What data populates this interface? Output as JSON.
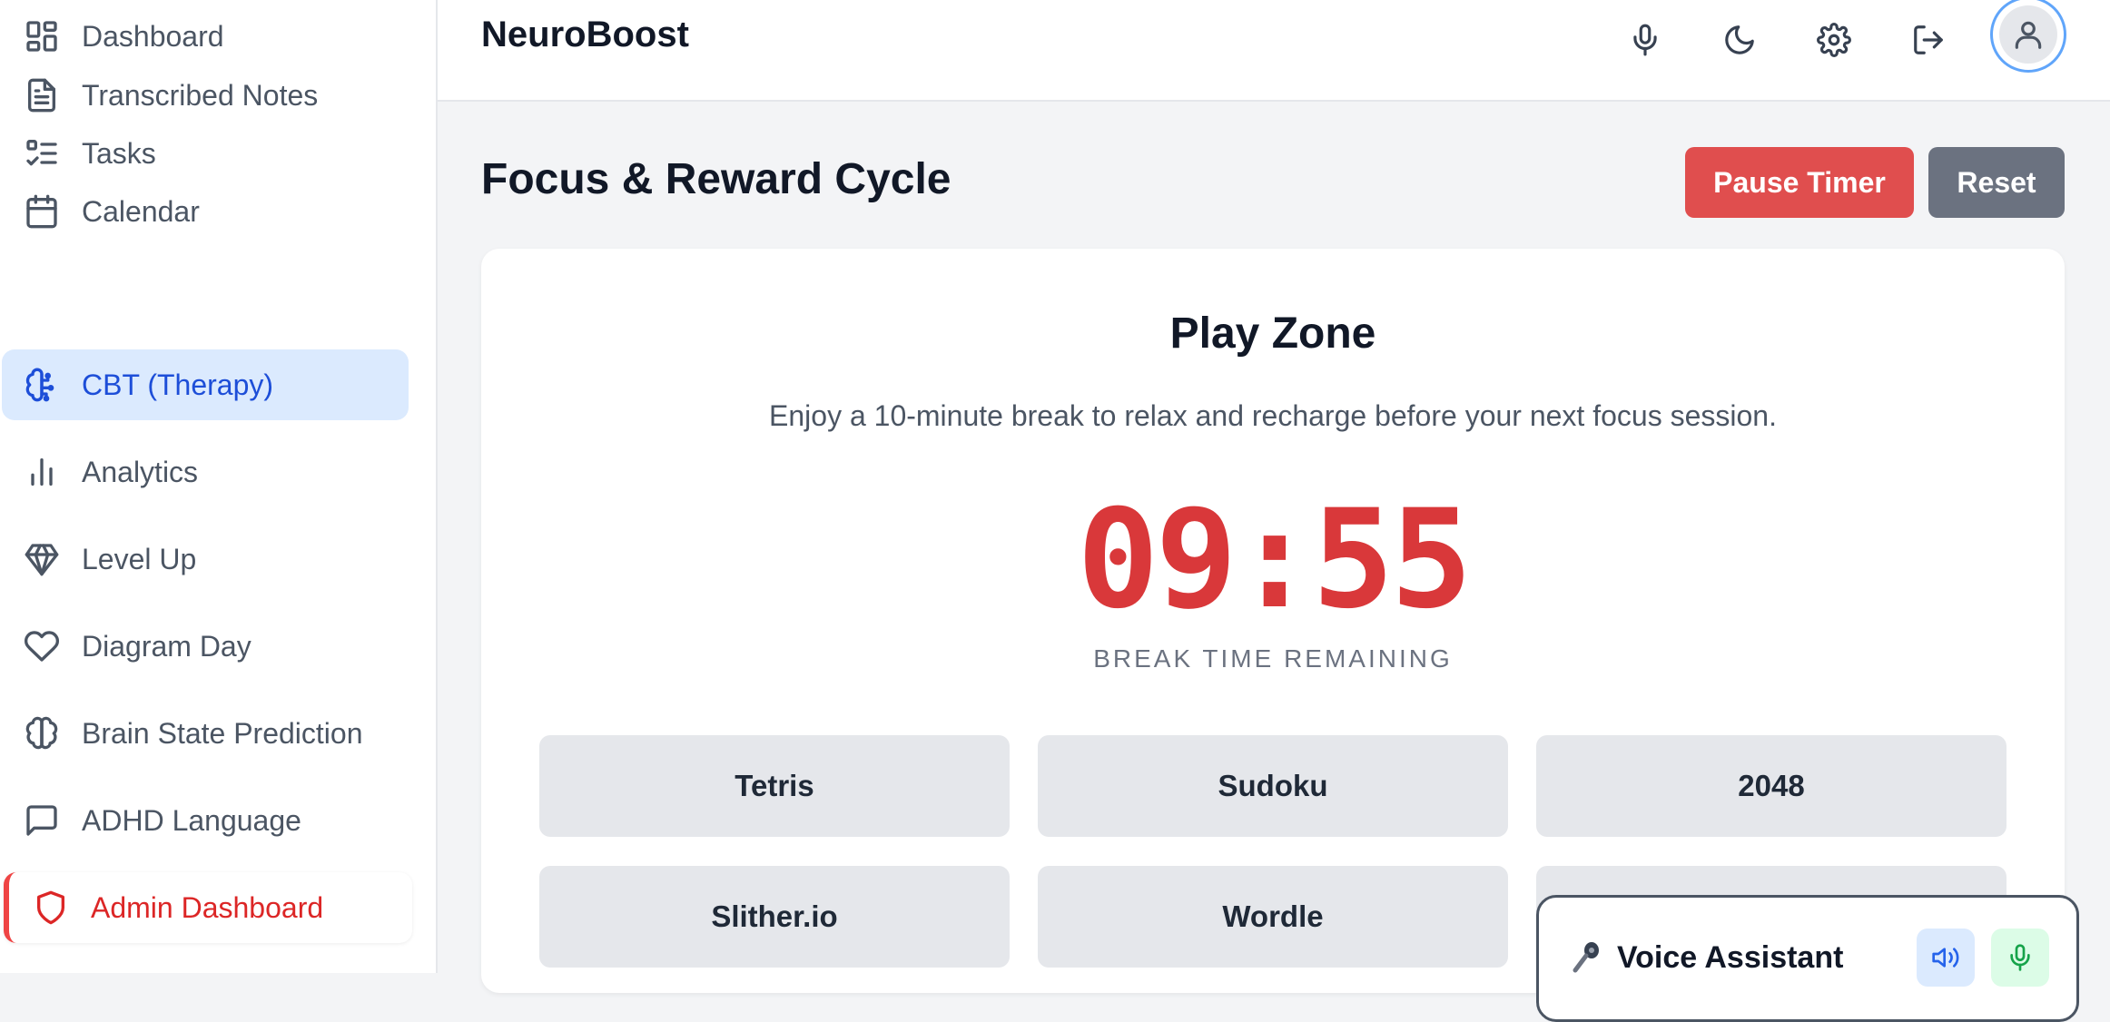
{
  "sidebar": {
    "items": [
      {
        "label": "Dashboard",
        "icon": "dashboard-icon"
      },
      {
        "label": "Transcribed Notes",
        "icon": "document-icon"
      },
      {
        "label": "Tasks",
        "icon": "checklist-icon"
      },
      {
        "label": "Calendar",
        "icon": "calendar-icon"
      },
      {
        "label": "CBT (Therapy)",
        "icon": "brain-circuit-icon",
        "active": true
      },
      {
        "label": "Analytics",
        "icon": "bar-chart-icon"
      },
      {
        "label": "Level Up",
        "icon": "gem-icon"
      },
      {
        "label": "Diagram Day",
        "icon": "heart-icon"
      },
      {
        "label": "Brain State Prediction",
        "icon": "brain-icon"
      },
      {
        "label": "ADHD Language",
        "icon": "message-icon"
      },
      {
        "label": "Admin Dashboard",
        "icon": "shield-icon"
      }
    ]
  },
  "header": {
    "brand": "NeuroBoost",
    "icons": [
      "microphone-icon",
      "moon-icon",
      "gear-icon",
      "logout-icon",
      "user-icon"
    ]
  },
  "main": {
    "title": "Focus & Reward Cycle",
    "pause_label": "Pause Timer",
    "reset_label": "Reset",
    "card": {
      "title": "Play Zone",
      "subtitle": "Enjoy a 10-minute break to relax and recharge before your next focus session.",
      "timer": "09:55",
      "timer_label": "BREAK TIME REMAINING",
      "games": [
        "Tetris",
        "Sudoku",
        "2048",
        "Slither.io",
        "Wordle"
      ]
    }
  },
  "voice_assistant": {
    "title": "Voice Assistant",
    "icons": [
      "microphone-emoji-icon",
      "speaker-icon",
      "microphone-icon"
    ]
  },
  "colors": {
    "accent": "#1d4ed8",
    "active_bg": "#dbeafe",
    "danger": "#e04e4e",
    "timer": "#d9383a",
    "neutral_button": "#6b7280",
    "game_tile": "#e5e7eb"
  }
}
